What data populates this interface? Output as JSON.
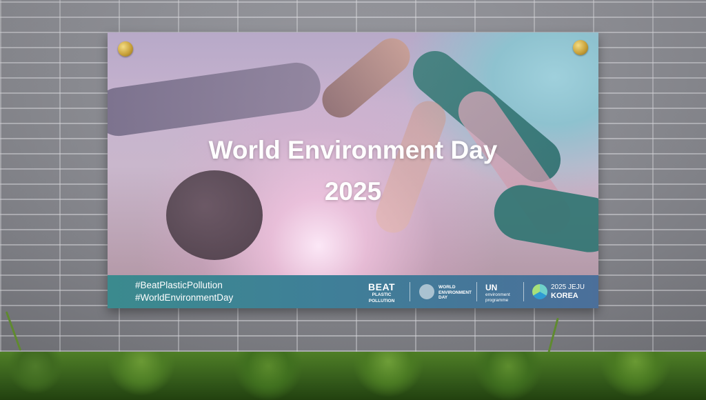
{
  "banner": {
    "title_line1": "World Environment Day",
    "title_line2": "2025",
    "hashtags": [
      "#BeatPlasticPollution",
      "#WorldEnvironmentDay"
    ],
    "logos": {
      "beat_big": "BEAT",
      "beat_small_1": "PLASTIC",
      "beat_small_2": "POLLUTION",
      "wed_lines": [
        "WORLD",
        "ENVIRONMENT",
        "DAY"
      ],
      "un_big": "UN",
      "un_small_1": "environment",
      "un_small_2": "programme",
      "korea_top": "2025 JEJU",
      "korea_bottom": "KOREA"
    }
  },
  "colors": {
    "footer_left": "#3b8a8e",
    "footer_right": "#4b6f9a",
    "bolt": "#c9a23a",
    "hedge": "#4f7f27"
  },
  "icons": [
    "wed-globe-icon",
    "jeju-korea-emblem-icon",
    "un-environment-emblem-icon"
  ]
}
